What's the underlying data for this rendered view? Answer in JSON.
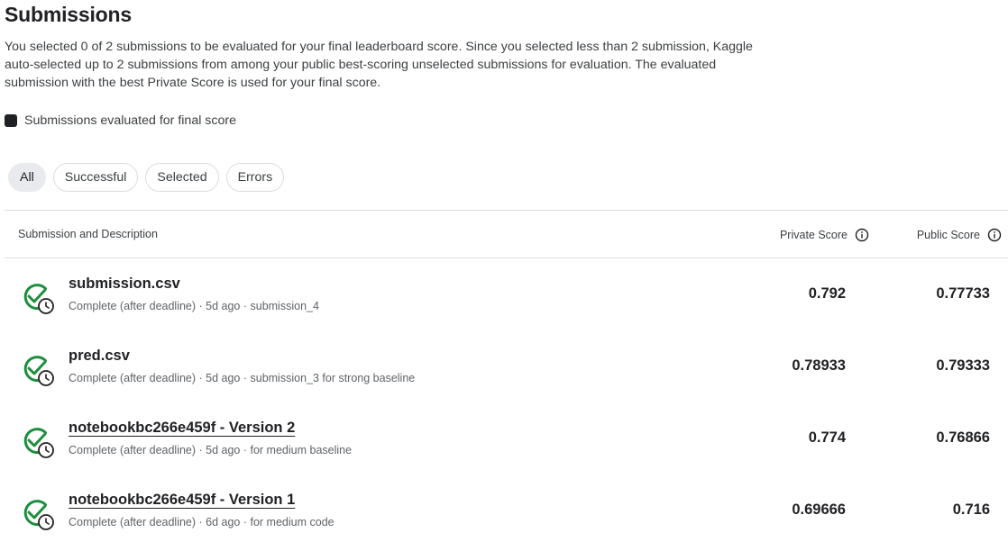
{
  "page": {
    "title": "Submissions",
    "description": "You selected 0 of 2 submissions to be evaluated for your final leaderboard score. Since you selected less than 2 submission, Kaggle auto-selected up to 2 submissions from among your public best-scoring unselected submissions for evaluation. The evaluated submission with the best Private Score is used for your final score.",
    "legend_label": "Submissions evaluated for final score"
  },
  "filters": [
    "All",
    "Successful",
    "Selected",
    "Errors"
  ],
  "active_filter": "All",
  "table": {
    "headers": {
      "submission": "Submission and Description",
      "private": "Private Score",
      "public": "Public Score"
    },
    "rows": [
      {
        "name": "submission.csv",
        "meta": "Complete (after deadline) · 5d ago · submission_4",
        "private": "0.792",
        "public": "0.77733",
        "link": false
      },
      {
        "name": "pred.csv",
        "meta": "Complete (after deadline) · 5d ago · submission_3 for strong baseline",
        "private": "0.78933",
        "public": "0.79333",
        "link": false
      },
      {
        "name": "notebookbc266e459f - Version 2",
        "meta": "Complete (after deadline) · 5d ago · for medium baseline",
        "private": "0.774",
        "public": "0.76866",
        "link": true
      },
      {
        "name": "notebookbc266e459f - Version 1",
        "meta": "Complete (after deadline) · 6d ago · for medium code",
        "private": "0.69666",
        "public": "0.716",
        "link": true
      }
    ]
  },
  "colors": {
    "success": "#1e8e3e",
    "text": "#202124",
    "muted": "#5f6368",
    "border": "#dadce0",
    "chip_active": "#e8eaed"
  },
  "icons": {
    "status": "check-circle-clock-icon",
    "info": "info-circle-icon"
  }
}
